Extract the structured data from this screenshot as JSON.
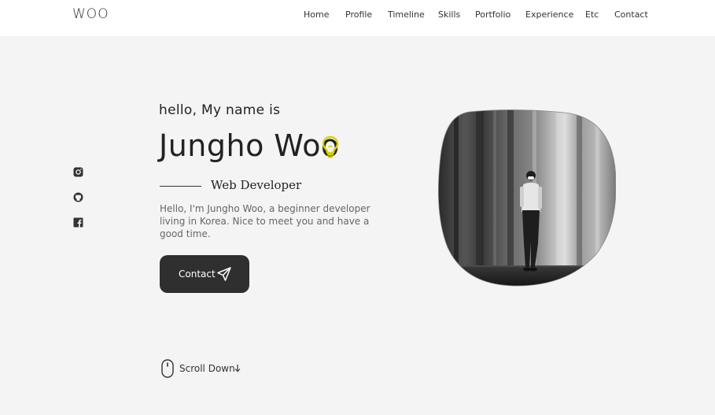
{
  "header": {
    "logo": "WOO",
    "nav": [
      "Home",
      "Profile",
      "Timeline",
      "Skills",
      "Portfolio",
      "Experience",
      "Etc",
      "Contact"
    ]
  },
  "socials": [
    "instagram-icon",
    "github-icon",
    "facebook-icon"
  ],
  "hero": {
    "greeting": "hello, My name is",
    "name": "Jungho Woo",
    "role": "Web Developer",
    "description": "Hello, I'm Jungho Woo, a beginner developer living in Korea. Nice to meet you and have a good time.",
    "contact_button": "Contact"
  },
  "scroll": {
    "label": "Scroll Down"
  },
  "colors": {
    "background": "#f4f4f4",
    "header": "#ffffff",
    "button": "#2f2f2f",
    "bulb": "#d8d200"
  }
}
